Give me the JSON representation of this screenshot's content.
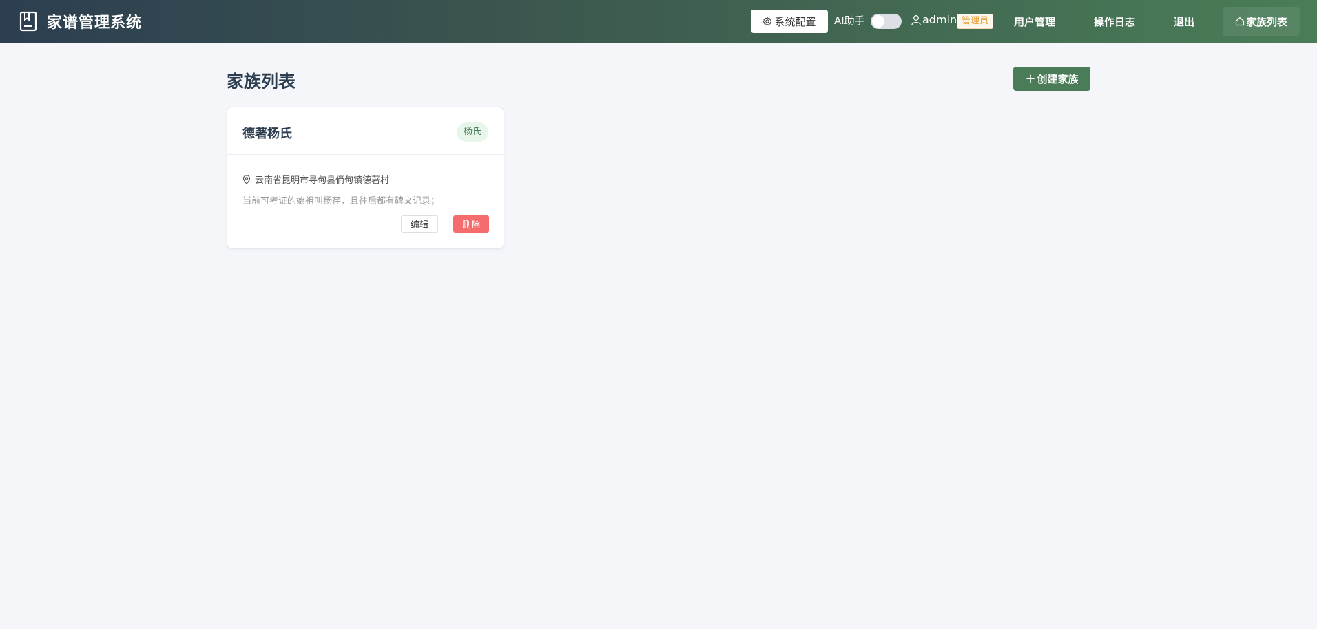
{
  "header": {
    "title": "家谱管理系统",
    "brand_icon": "book-icon",
    "config_label": "系统配置",
    "ai_label": "AI助手",
    "ai_enabled": false,
    "username": "admin",
    "role": "管理员",
    "nav": {
      "users": "用户管理",
      "logs": "操作日志",
      "logout": "退出",
      "families": "家族列表"
    }
  },
  "main": {
    "title": "家族列表",
    "create_label": "创建家族",
    "families": [
      {
        "name": "德著杨氏",
        "surname_tag": "杨氏",
        "location": "云南省昆明市寻甸县倘甸镇德著村",
        "description": "当前可考证的始祖叫杨荏，且往后都有碑文记录；",
        "edit_label": "编辑",
        "delete_label": "删除"
      }
    ]
  },
  "colors": {
    "header_start": "#2c3e50",
    "header_end": "#4a7d57",
    "primary": "#4a7d57",
    "danger": "#f56c6c",
    "warning": "#e6a23c",
    "page_bg": "#f5f6fa"
  }
}
